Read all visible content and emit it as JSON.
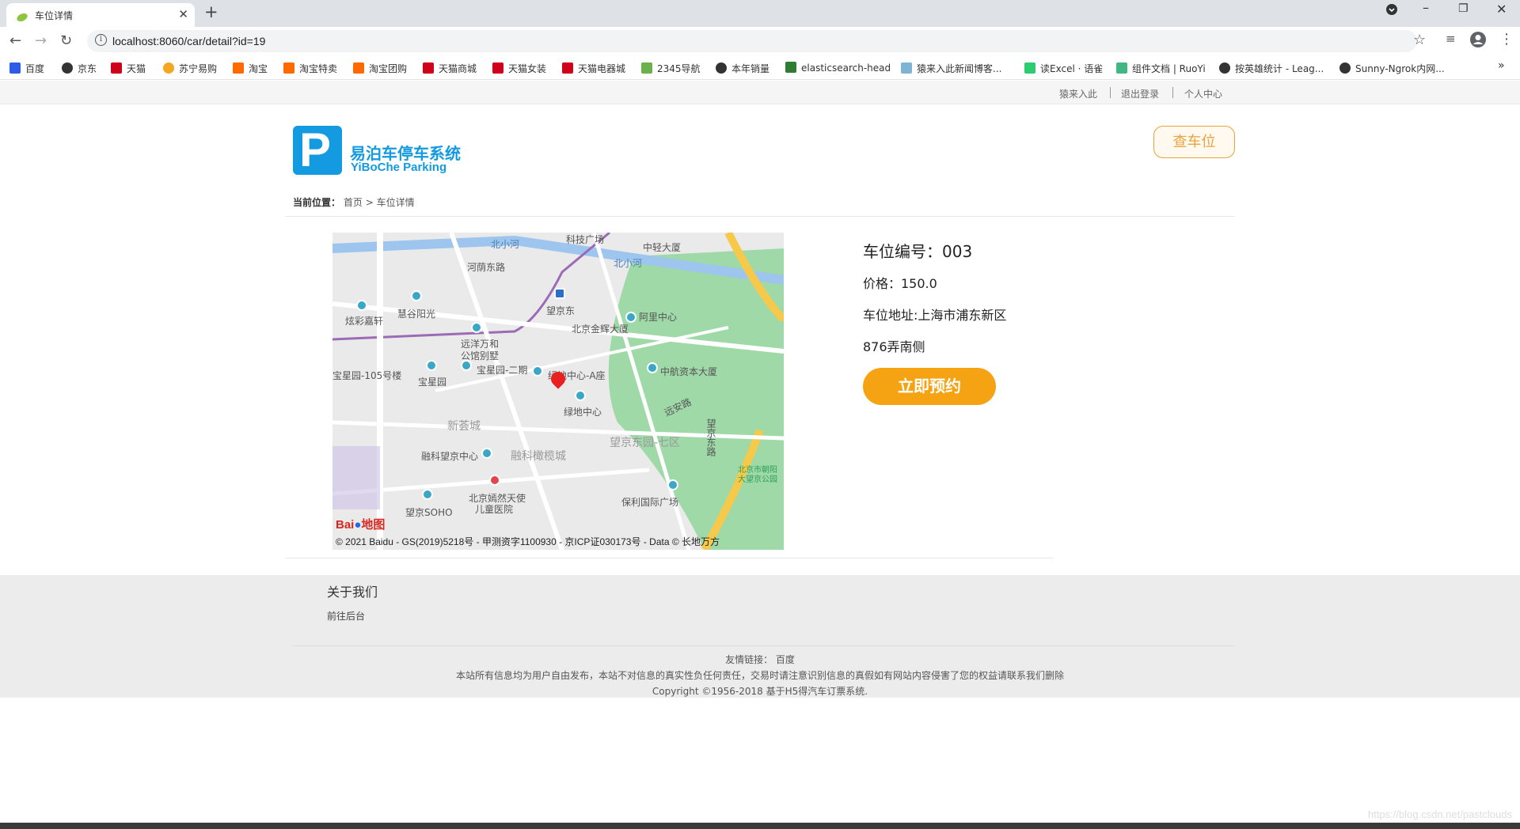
{
  "browser": {
    "tab_title": "车位详情",
    "url": "localhost:8060/car/detail?id=19",
    "bookmarks": [
      "百度",
      "京东",
      "天猫",
      "苏宁易购",
      "淘宝",
      "淘宝特卖",
      "淘宝团购",
      "天猫商城",
      "天猫女装",
      "天猫电器城",
      "2345导航",
      "本年销量",
      "elasticsearch-head",
      "猿来入此新闻博客...",
      "读Excel · 语雀",
      "组件文档 | RuoYi",
      "按英雄统计 - Leag...",
      "Sunny-Ngrok内网..."
    ],
    "bookmark_more": "»",
    "colors": {
      "tab_bar": "#dee1e6"
    }
  },
  "topnav": {
    "links": [
      "猿来入此",
      "退出登录",
      "个人中心"
    ]
  },
  "logo": {
    "badge_letter": "P",
    "name_cn": "易泊车停车系统",
    "name_en": "YiBoChe  Parking"
  },
  "header": {
    "find_button": "查车位"
  },
  "breadcrumb": {
    "prefix": "当前位置：",
    "home": "首页",
    "separator": ">",
    "current": "车位详情"
  },
  "map": {
    "copyright": "© 2021 Baidu - GS(2019)5218号 - 甲测资字1100930 - 京ICP证030173号 - Data © 长地万方",
    "logo_bai": "Bai",
    "logo_du": "地图",
    "labels": [
      "科技广场",
      "中轻大厦",
      "北小河",
      "北小河",
      "河荫东路",
      "望京东",
      "慧谷阳光",
      "炫彩嘉轩",
      "阿里中心",
      "北京金辉大厦",
      "远洋万和",
      "公馆别墅",
      "宝星园-二期",
      "绿地中心-A座",
      "中航资本大厦",
      "宝星园",
      "宝星园-105号楼",
      "绿地中心",
      "远安路",
      "新荟城",
      "望京东园-七区",
      "望京东路",
      "融科望京中心",
      "融科橄榄城",
      "北京市朝阳大望京公园",
      "北京嫣然天使",
      "儿童医院",
      "保利国际广场",
      "望京SOHO"
    ]
  },
  "detail": {
    "spot_no": "车位编号：003",
    "price": "价格：150.0",
    "address_line1": "车位地址:上海市浦东新区",
    "address_line2": "876弄南侧",
    "book_button": "立即预约",
    "colors": {
      "book_button": "#f5a313",
      "find_button": "#e8a33a",
      "brand": "#139ae0"
    }
  },
  "footer": {
    "about_title": "关于我们",
    "about_link": "前往后台",
    "friend_links_label": "友情链接：",
    "friend_link": "百度",
    "disclaimer": "本站所有信息均为用户自由发布，本站不对信息的真实性负任何责任，交易时请注意识别信息的真假如有网站内容侵害了您的权益请联系我们删除",
    "copyright": "Copyright ©1956-2018 基于H5得汽车订票系统."
  },
  "watermark": "https://blog.csdn.net/pastclouds"
}
